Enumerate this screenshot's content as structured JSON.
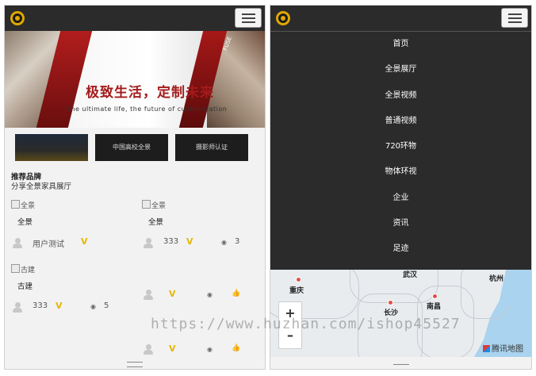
{
  "left": {
    "banner": {
      "title": "极致生活，定制未来",
      "subtitle": "The ultimate life, the future of customization",
      "corner_text": "FUSE"
    },
    "tiles": [
      "",
      "中国高校全景",
      "摄影师认证"
    ],
    "section": {
      "title": "推荐品牌",
      "subtitle": "分享全景家具展厅"
    },
    "cards": [
      {
        "img_alt": "全景",
        "title": "全景",
        "user": "用户测试",
        "badge": "V",
        "views": "",
        "likes": ""
      },
      {
        "img_alt": "全景",
        "title": "全景",
        "user": "333",
        "badge": "V",
        "views": "3",
        "likes": ""
      },
      {
        "img_alt": "古建",
        "title": "古建",
        "user": "333",
        "badge": "V",
        "views": "5",
        "likes": ""
      },
      {
        "img_alt": "",
        "title": "",
        "user": "",
        "badge": "V",
        "views": "",
        "likes": ""
      },
      {
        "img_alt": "",
        "title": "",
        "user": "",
        "badge": "V",
        "views": "",
        "likes": ""
      }
    ],
    "eye_icon": "◉",
    "thumb_icon": "👍"
  },
  "right": {
    "menu": [
      "首页",
      "全景展厅",
      "全景视频",
      "普通视频",
      "720环物",
      "物体环视",
      "企业",
      "资讯",
      "足迹"
    ],
    "map": {
      "cities": [
        "重庆",
        "武汉",
        "杭州",
        "长沙",
        "南昌"
      ],
      "zoom_in": "+",
      "zoom_out": "–",
      "brand": "腾讯地图"
    }
  },
  "watermark": "https://www.huzhan.com/ishop45527",
  "colors": {
    "topbar": "#2b2b2b",
    "accent_red": "#a41b1b",
    "badge_yellow": "#e6b800",
    "logo_gold": "#e0a800"
  }
}
